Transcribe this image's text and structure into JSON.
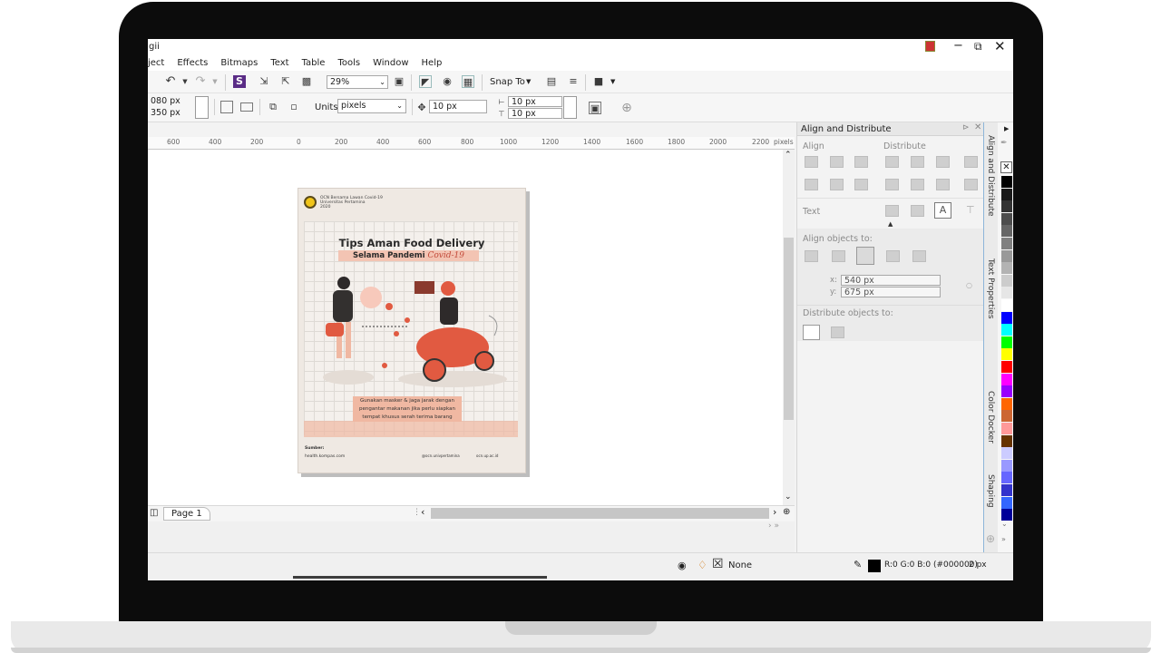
{
  "window": {
    "title_fragment": "gii"
  },
  "menu": [
    "ject",
    "Effects",
    "Bitmaps",
    "Text",
    "Table",
    "Tools",
    "Window",
    "Help"
  ],
  "toolbar": {
    "zoom": "29%",
    "snap_to": "Snap To"
  },
  "property_bar": {
    "width": "080 px",
    "height": "350 px",
    "units_label": "Units:",
    "units_value": "pixels",
    "nudge": "10 px",
    "dup_x": "10 px",
    "dup_y": "10 px"
  },
  "ruler": {
    "ticks": [
      "600",
      "400",
      "200",
      "0",
      "200",
      "400",
      "600",
      "800",
      "1000",
      "1200",
      "1400",
      "1600",
      "1800",
      "2000",
      "2200"
    ],
    "unit": "pixels"
  },
  "page_tab": "Page 1",
  "docker": {
    "title": "Align and Distribute",
    "align_label": "Align",
    "distribute_label": "Distribute",
    "text_label": "Text",
    "align_objects_to": "Align objects to:",
    "x_label": "x:",
    "x_value": "540 px",
    "y_label": "y:",
    "y_value": "675 px",
    "distribute_objects_to": "Distribute objects to:"
  },
  "side_tabs": [
    "Align and Distribute",
    "Text Properties",
    "Color Docker",
    "Shaping"
  ],
  "status": {
    "fill": "None",
    "outline": "R:0 G:0 B:0 (#000000)",
    "outline_width": "2 px"
  },
  "poster": {
    "org_line1": "OCN Bersama Lawan Covid-19",
    "org_line2": "Universitas Pertamina",
    "org_line3": "2020",
    "title": "Tips Aman Food Delivery",
    "subtitle": "Selama Pandemi",
    "script_word": "Covid-19",
    "caption_line1": "Gunakan masker & jaga jarak dengan",
    "caption_line2": "pengantar makanan jika perlu siapkan",
    "caption_line3": "tempat khusus serah terima barang",
    "source_label": "Sumber:",
    "source": "health.kompas.com",
    "instagram": "@ocn.univpertamina",
    "web": "ocn.up.ac.id"
  },
  "colors": {
    "palette": [
      "#000000",
      "#1a1a1a",
      "#333333",
      "#4d4d4d",
      "#666666",
      "#808080",
      "#999999",
      "#b3b3b3",
      "#cccccc",
      "#e6e6e6",
      "#ffffff",
      "#0000ff",
      "#00ffff",
      "#00ff00",
      "#ffff00",
      "#ff0000",
      "#ff00ff",
      "#9900ff",
      "#ff6600",
      "#cc6633",
      "#ff9999",
      "#663300",
      "#ccccff",
      "#9999ff",
      "#6666ff",
      "#3333cc",
      "#3366ff",
      "#000099"
    ]
  }
}
